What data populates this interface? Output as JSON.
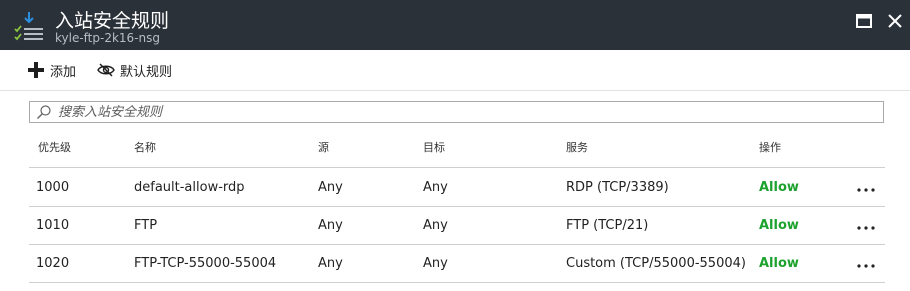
{
  "window": {
    "title": "入站安全规则",
    "subtitle": "kyle-ftp-2k16-nsg",
    "app_icon": "inbound-rules-icon",
    "maximize_icon": "maximize-icon",
    "close_icon": "close-icon"
  },
  "toolbar": {
    "add_label": "添加",
    "default_rules_label": "默认规则"
  },
  "search": {
    "placeholder": "搜索入站安全规则",
    "value": ""
  },
  "table": {
    "headers": {
      "priority": "优先级",
      "name": "名称",
      "source": "源",
      "destination": "目标",
      "service": "服务",
      "action": "操作"
    },
    "rows": [
      {
        "priority": "1000",
        "name": "default-allow-rdp",
        "source": "Any",
        "destination": "Any",
        "service": "RDP (TCP/3389)",
        "action": "Allow"
      },
      {
        "priority": "1010",
        "name": "FTP",
        "source": "Any",
        "destination": "Any",
        "service": "FTP (TCP/21)",
        "action": "Allow"
      },
      {
        "priority": "1020",
        "name": "FTP-TCP-55000-55004",
        "source": "Any",
        "destination": "Any",
        "service": "Custom (TCP/55000-55004)",
        "action": "Allow"
      }
    ]
  },
  "colors": {
    "titlebar_bg": "#2a3138",
    "allow_green": "#1da22e",
    "icon_blue": "#2b8fe0",
    "icon_green": "#8cc63f"
  }
}
